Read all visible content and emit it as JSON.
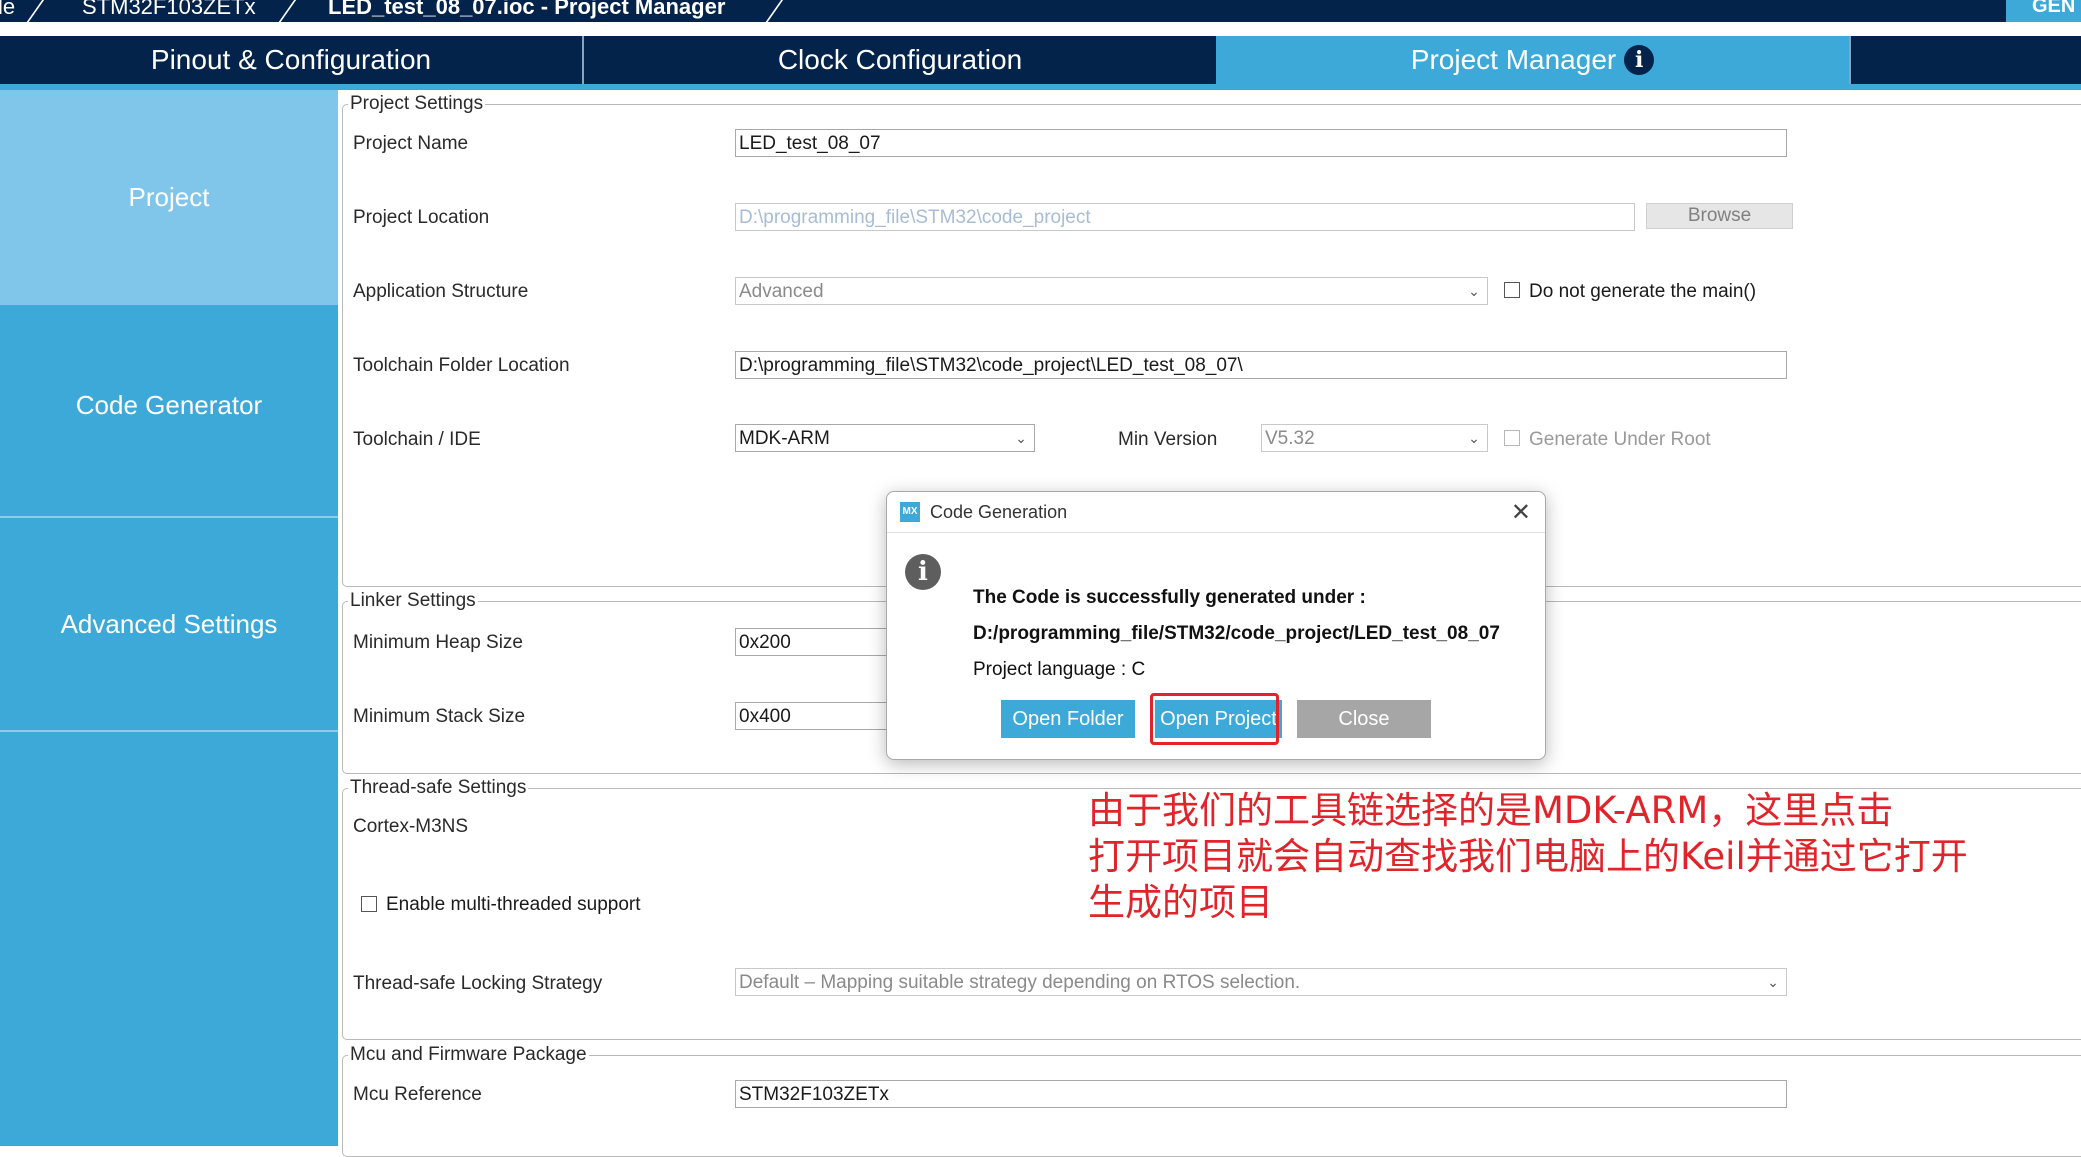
{
  "breadcrumb": {
    "items": [
      "le",
      "STM32F103ZETx",
      "LED_test_08_07.ioc - Project Manager"
    ],
    "generate_label": "GEN"
  },
  "tabs": [
    {
      "label": "Pinout & Configuration",
      "active": false
    },
    {
      "label": "Clock Configuration",
      "active": false
    },
    {
      "label": "Project Manager",
      "active": true
    }
  ],
  "sidebar": {
    "items": [
      {
        "label": "Project",
        "active": true
      },
      {
        "label": "Code Generator",
        "active": false
      },
      {
        "label": "Advanced Settings",
        "active": false
      }
    ]
  },
  "project_settings": {
    "legend": "Project Settings",
    "project_name_label": "Project Name",
    "project_name_value": "LED_test_08_07",
    "project_location_label": "Project Location",
    "project_location_value": "D:\\programming_file\\STM32\\code_project",
    "browse_label": "Browse",
    "app_structure_label": "Application Structure",
    "app_structure_value": "Advanced",
    "no_main_label": "Do not generate the main()",
    "toolchain_folder_label": "Toolchain Folder Location",
    "toolchain_folder_value": "D:\\programming_file\\STM32\\code_project\\LED_test_08_07\\",
    "toolchain_ide_label": "Toolchain / IDE",
    "toolchain_ide_value": "MDK-ARM",
    "min_version_label": "Min Version",
    "min_version_value": "V5.32",
    "generate_under_root_label": "Generate Under Root"
  },
  "linker_settings": {
    "legend": "Linker Settings",
    "heap_label": "Minimum Heap Size",
    "heap_value": "0x200",
    "stack_label": "Minimum Stack Size",
    "stack_value": "0x400"
  },
  "thread_safe": {
    "legend": "Thread-safe Settings",
    "core_label": "Cortex-M3NS",
    "multithread_label": "Enable multi-threaded support",
    "locking_label": "Thread-safe Locking Strategy",
    "locking_value": "Default – Mapping suitable strategy depending on RTOS selection."
  },
  "mcu_package": {
    "legend": "Mcu and Firmware Package",
    "mcu_ref_label": "Mcu Reference",
    "mcu_ref_value": "STM32F103ZETx"
  },
  "dialog": {
    "icon_text": "MX",
    "title": "Code Generation",
    "line1": "The Code is successfully generated under :",
    "line2": "D:/programming_file/STM32/code_project/LED_test_08_07",
    "line3": "Project language : C",
    "open_folder": "Open Folder",
    "open_project": "Open Project",
    "close": "Close"
  },
  "annotation": {
    "lines": [
      "由于我们的工具链选择的是MDK-ARM，这里点击",
      "打开项目就会自动查找我们电脑上的Keil并通过它打开",
      "生成的项目"
    ],
    "color": "#e0242a"
  },
  "colors": {
    "navy": "#03234b",
    "accent": "#3ca9d9",
    "sidebar_active": "#7fc6ea"
  }
}
